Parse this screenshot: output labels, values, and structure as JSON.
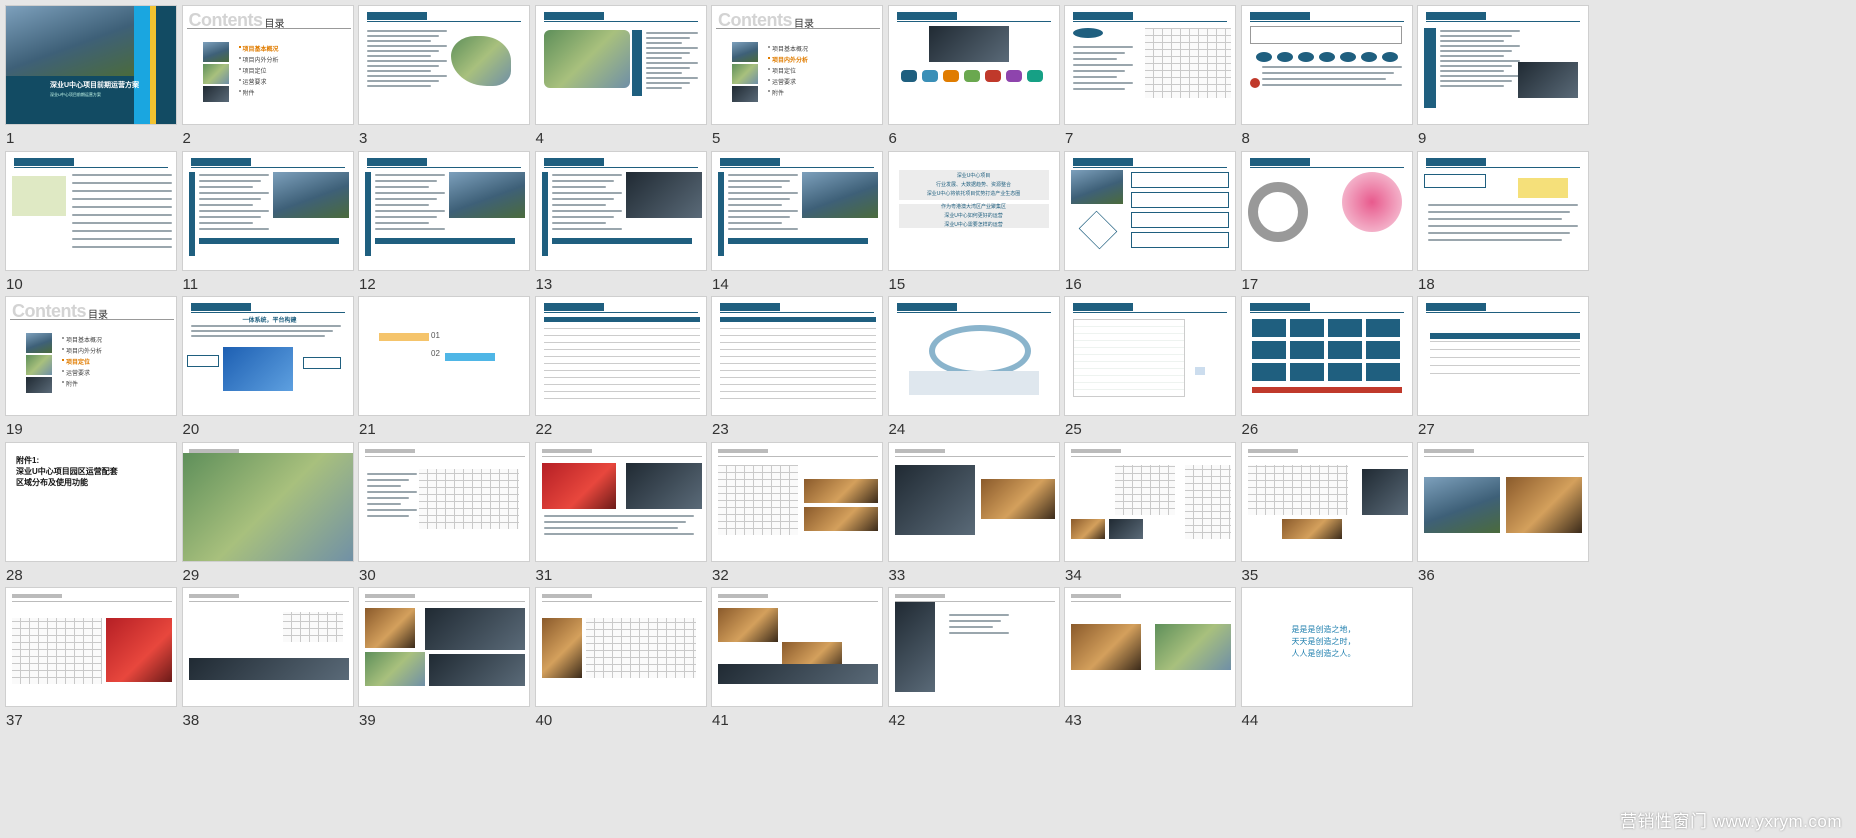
{
  "slides": [
    {
      "n": "1",
      "title": "深业U中心项目前期运营方案",
      "subtitle": "深业U中心项目前期运营方案"
    },
    {
      "n": "2",
      "contents": "Contents",
      "contents_cn": "目录",
      "toc": [
        "项目基本概况",
        "项目内外分析",
        "项目定位",
        "运营要求",
        "附件"
      ]
    },
    {
      "n": "3",
      "header": "一、项目基本概况",
      "sub": "（一）区域规划"
    },
    {
      "n": "4",
      "header": "一、项目基本概况",
      "sub": "（二）项目技术指标"
    },
    {
      "n": "5",
      "contents": "Contents",
      "contents_cn": "目录",
      "toc": [
        "项目基本概况",
        "项目内外分析",
        "项目定位",
        "运营要求",
        "附件"
      ]
    },
    {
      "n": "6",
      "header": "二、项目内外分析"
    },
    {
      "n": "7",
      "header": "二、项目内外分析"
    },
    {
      "n": "8",
      "header": "二、项目内外分析"
    },
    {
      "n": "9",
      "header": "二、项目内外分析"
    },
    {
      "n": "10",
      "header": "二、项目内外分析"
    },
    {
      "n": "11"
    },
    {
      "n": "12"
    },
    {
      "n": "13"
    },
    {
      "n": "14"
    },
    {
      "n": "15",
      "lines": [
        "深业U中心项目",
        "行业发展、大数据趋势、资源整合",
        "深业U中心将依托项目优势打造产业生态圈",
        "作为粤港澳大湾区产业聚集区",
        "深业U中心如何更好的运营",
        "深业U中心需要怎样的运营"
      ]
    },
    {
      "n": "16"
    },
    {
      "n": "17"
    },
    {
      "n": "18"
    },
    {
      "n": "19",
      "contents": "Contents",
      "contents_cn": "目录",
      "toc": [
        "项目基本概况",
        "项目内外分析",
        "项目定位",
        "运营要求",
        "附件"
      ]
    },
    {
      "n": "20",
      "title": "一体系统，平台构建"
    },
    {
      "n": "21",
      "items": [
        "01",
        "02"
      ]
    },
    {
      "n": "22"
    },
    {
      "n": "23"
    },
    {
      "n": "24"
    },
    {
      "n": "25"
    },
    {
      "n": "26"
    },
    {
      "n": "27"
    },
    {
      "n": "28",
      "title": "附件1:\n深业U中心项目园区运营配套\n区域分布及使用功能"
    },
    {
      "n": "29"
    },
    {
      "n": "30"
    },
    {
      "n": "31"
    },
    {
      "n": "32"
    },
    {
      "n": "33"
    },
    {
      "n": "34"
    },
    {
      "n": "35"
    },
    {
      "n": "36"
    },
    {
      "n": "37"
    },
    {
      "n": "38"
    },
    {
      "n": "39"
    },
    {
      "n": "40"
    },
    {
      "n": "41"
    },
    {
      "n": "42"
    },
    {
      "n": "43"
    },
    {
      "n": "44",
      "lines": [
        "是是是创造之地，",
        "天天是创造之时，",
        "人人是创造之人。"
      ]
    }
  ],
  "watermark": "营销性窗门 www.yxrym.com",
  "colors": {
    "accent": "#1f5f7f",
    "bg": "#e6e6e6",
    "highlight": "#e07c00"
  }
}
